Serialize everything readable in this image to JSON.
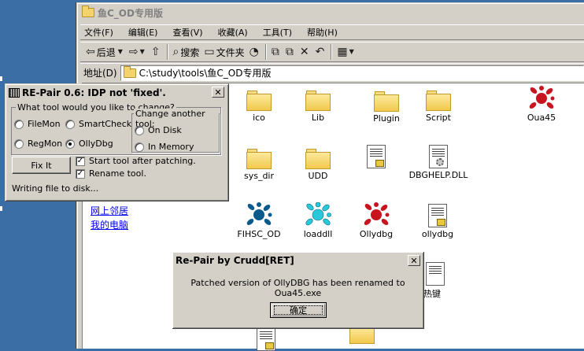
{
  "explorer": {
    "title": "鱼C_OD专用版",
    "menu": [
      "文件(F)",
      "编辑(E)",
      "查看(V)",
      "收藏(A)",
      "工具(T)",
      "帮助(H)"
    ],
    "toolbar": {
      "back": "后退",
      "search": "搜索",
      "folders": "文件夹"
    },
    "address_label": "地址(D)",
    "address_value": "C:\\study\\tools\\鱼C_OD专用版",
    "links": [
      "网上邻居",
      "我的电脑"
    ],
    "files": [
      {
        "name": "ico",
        "type": "folder"
      },
      {
        "name": "Lib",
        "type": "folder"
      },
      {
        "name": "Plugin",
        "type": "folder"
      },
      {
        "name": "Script",
        "type": "folder"
      },
      {
        "name": "Oua45",
        "type": "splat-red"
      },
      {
        "name": "sys_dir",
        "type": "folder"
      },
      {
        "name": "UDD",
        "type": "folder"
      },
      {
        "name": "",
        "type": "ini"
      },
      {
        "name": "DBGHELP.DLL",
        "type": "dll"
      },
      {
        "name": "FIHSC_OD",
        "type": "splat-blue"
      },
      {
        "name": "loaddll",
        "type": "splat-cyan"
      },
      {
        "name": "Ollydbg",
        "type": "splat-red"
      },
      {
        "name": "ollydbg",
        "type": "ini"
      },
      {
        "name": "用热键",
        "type": "ini"
      }
    ]
  },
  "repair": {
    "title": "RE-Pair 0.6: IDP not 'fixed'.",
    "close": "✕",
    "tool_group": "What tool would you like to change?",
    "options": [
      "FileMon",
      "SmartCheck",
      "RegMon",
      "OllyDbg"
    ],
    "selected_tool": "OllyDbg",
    "another_group": "Change another tool:",
    "another_options": [
      "On Disk",
      "In Memory"
    ],
    "fix_button": "Fix It",
    "start_after": "Start tool after patching.",
    "start_after_checked": true,
    "rename": "Rename tool.",
    "rename_checked": true,
    "status": "Writing file to disk..."
  },
  "msgbox": {
    "title": "Re-Pair by Crudd[RET]",
    "close": "✕",
    "message": "Patched version of OllyDBG has been renamed to Oua45.exe",
    "ok": "确定"
  },
  "colors": {
    "desktop": "#3a6ea5",
    "face": "#d4d0c8",
    "link": "#0000ee",
    "splat_red": "#c8141e",
    "splat_blue": "#0a5a8c",
    "splat_cyan": "#29c8dc"
  }
}
